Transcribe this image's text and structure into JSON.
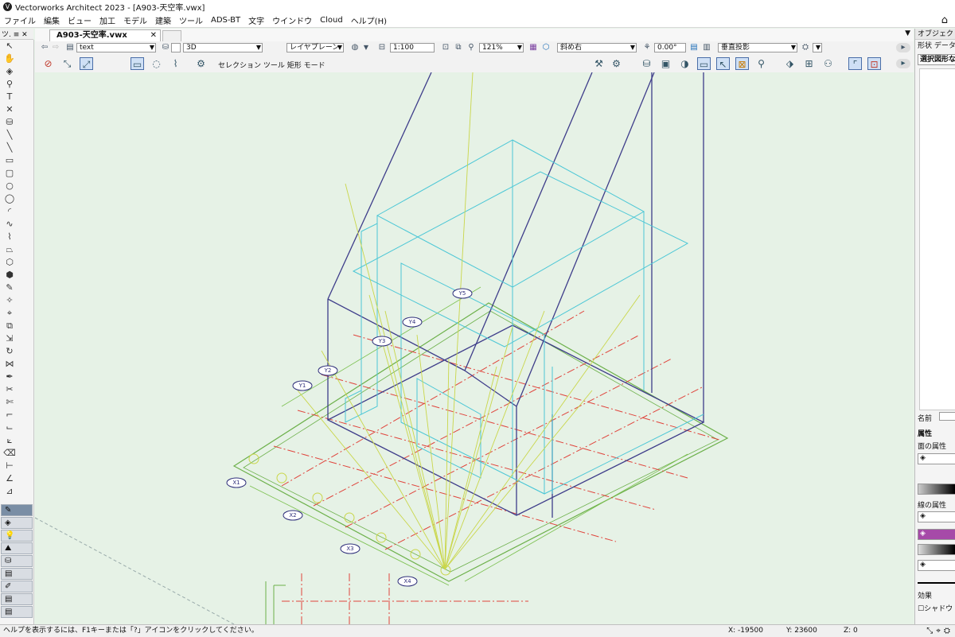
{
  "window": {
    "title": "Vectorworks Architect 2023 - [A903-天空率.vwx]"
  },
  "menu": [
    "ファイル",
    "編集",
    "ビュー",
    "加工",
    "モデル",
    "建築",
    "ツール",
    "ADS-BT",
    "文字",
    "ウインドウ",
    "Cloud",
    "ヘルプ(H)"
  ],
  "tool_palette": {
    "header": "ツ.  ≡  ✕"
  },
  "document_tab": {
    "label": "A903-天空率.vwx",
    "close": "✕"
  },
  "view_bar": {
    "class_value": "text",
    "layer_value": "3D",
    "plane_value": "レイヤプレーン",
    "scale_value": "1:100",
    "zoom_value": "121%",
    "view_value": "斜め右",
    "angle_value": "0.00°",
    "projection_value": "垂直投影"
  },
  "mode_bar": {
    "mode_text": "セレクション ツール 矩形 モード"
  },
  "obj_info": {
    "title": "オブジェクト情報",
    "tabs": "形状  データ",
    "selection": "選択図形な",
    "name_label": "名前",
    "attributes_label": "属性",
    "fill_label": "面の属性",
    "line_label": "線の属性",
    "effects_label": "効果",
    "shadow_label": "シャドウ",
    "pen_color": "#a64aa8"
  },
  "status": {
    "help": "ヘルプを表示するには、F1キーまたは「?」アイコンをクリックしてください。",
    "x": "X: -19500",
    "y": "Y: 23600",
    "z": "Z: 0"
  },
  "drawing": {
    "grid_labels": [
      "X1",
      "X2",
      "X3",
      "X4",
      "Y1",
      "Y2",
      "Y3",
      "Y4",
      "Y5"
    ]
  }
}
